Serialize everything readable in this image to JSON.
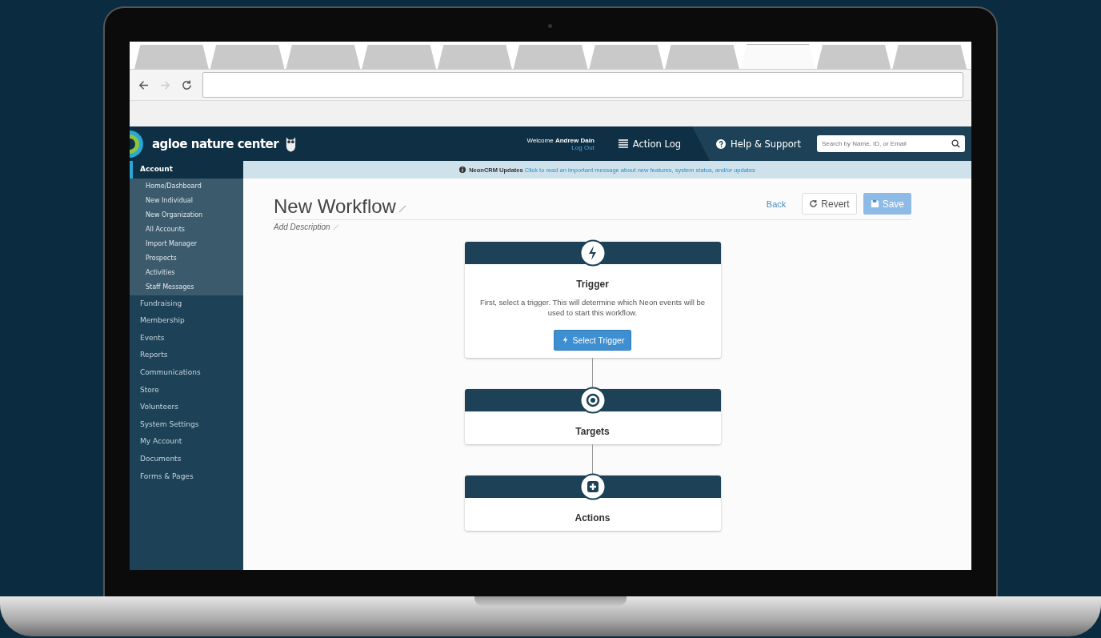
{
  "browser": {
    "tabs": [
      {
        "selected": false
      },
      {
        "selected": false
      },
      {
        "selected": false
      },
      {
        "selected": false
      },
      {
        "selected": false
      },
      {
        "selected": false
      },
      {
        "selected": false
      },
      {
        "selected": false
      },
      {
        "selected": true
      },
      {
        "selected": false
      },
      {
        "selected": false
      }
    ],
    "forward_disabled": true
  },
  "header": {
    "brand": "agloe nature center",
    "welcome": "Welcome",
    "user": "Andrew Dain",
    "logout": "Log Out",
    "action_log": "Action Log",
    "help": "Help & Support",
    "search": {
      "placeholder": "Search by Name, ID, or Email"
    }
  },
  "sidebar": {
    "items": [
      {
        "label": "Account",
        "selected": true,
        "expanded": true,
        "children": [
          {
            "label": "Home/Dashboard",
            "selected": false
          },
          {
            "label": "New Individual",
            "selected": false
          },
          {
            "label": "New Organization",
            "selected": false
          },
          {
            "label": "All Accounts",
            "selected": false
          },
          {
            "label": "Import Manager",
            "selected": false
          },
          {
            "label": "Prospects",
            "selected": false
          },
          {
            "label": "Activities",
            "selected": false
          },
          {
            "label": "Staff Messages",
            "selected": false
          }
        ]
      },
      {
        "label": "Fundraising",
        "selected": false
      },
      {
        "label": "Membership",
        "selected": false
      },
      {
        "label": "Events",
        "selected": false
      },
      {
        "label": "Reports",
        "selected": false
      },
      {
        "label": "Communications",
        "selected": false
      },
      {
        "label": "Store",
        "selected": false
      },
      {
        "label": "Volunteers",
        "selected": false
      },
      {
        "label": "System Settings",
        "selected": false
      },
      {
        "label": "My Account",
        "selected": false
      },
      {
        "label": "Documents",
        "selected": false
      },
      {
        "label": "Forms & Pages",
        "selected": false
      }
    ]
  },
  "notice": {
    "title": "NeonCRM Updates",
    "link": "Click to read an important message about new features, system status, and/or updates"
  },
  "page": {
    "title": "New Workflow",
    "description": "Add Description",
    "actions": [
      {
        "kind": "link",
        "label": "Back",
        "disabled": false
      },
      {
        "kind": "default",
        "label": "Revert",
        "disabled": false
      },
      {
        "kind": "primary",
        "label": "Save",
        "disabled": true
      }
    ]
  },
  "steps": [
    {
      "kind": "trigger",
      "title": "Trigger",
      "description": "First, select a trigger. This will determine which Neon events will be used to start this workflow.",
      "button": "Select Trigger"
    },
    {
      "kind": "targets",
      "title": "Targets"
    },
    {
      "kind": "actions",
      "title": "Actions"
    }
  ]
}
